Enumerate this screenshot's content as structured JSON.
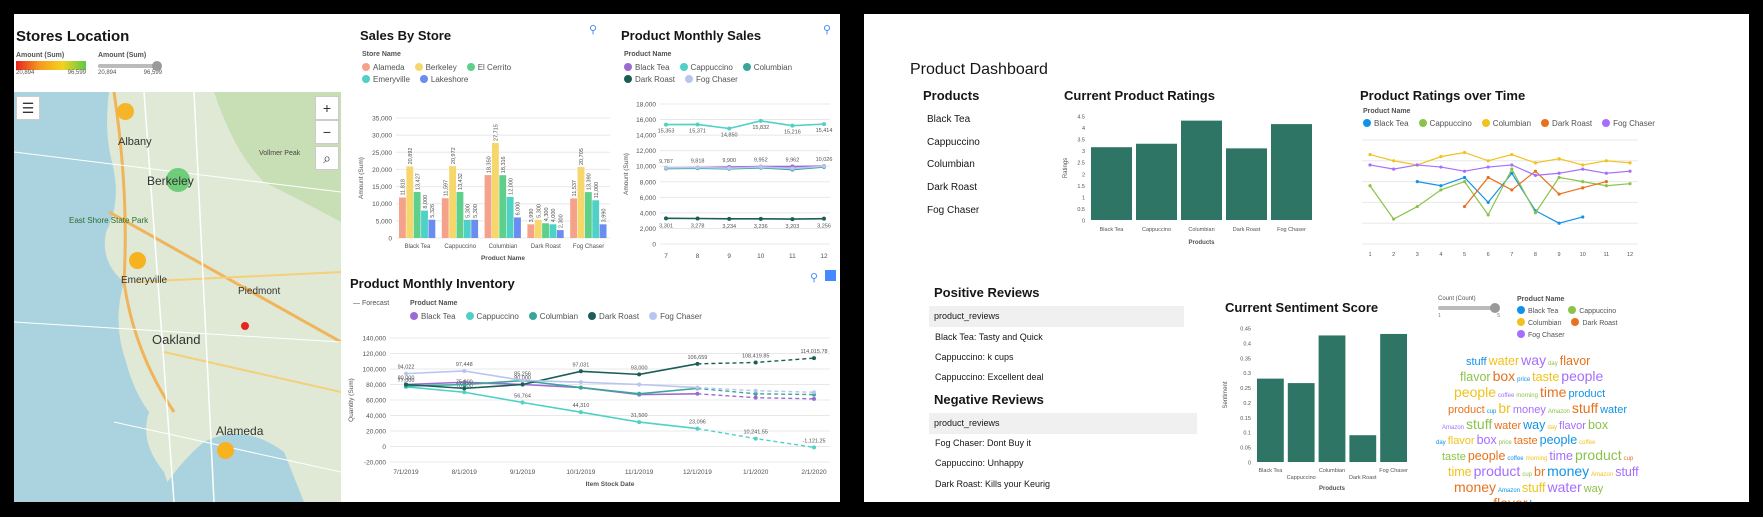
{
  "left": {
    "map": {
      "title": "Stores Location",
      "legend_amount_label": "Amount (Sum)",
      "legend_amount_min": "20,894",
      "legend_amount_max": "96,599",
      "legend_size_label": "Amount (Sum)",
      "legend_size_min": "20,894",
      "legend_size_max": "96,599",
      "places": [
        "Albany",
        "Berkeley",
        "East Shore State Park",
        "Emeryville",
        "Piedmont",
        "Oakland",
        "Alameda",
        "Vollmer Peak"
      ],
      "zoom_in": "+",
      "zoom_out": "−"
    },
    "sales_by_store": {
      "title": "Sales By Store",
      "legend_title": "Store Name",
      "x_title": "Product Name",
      "y_title": "Amount (Sum)"
    },
    "monthly_sales": {
      "title": "Product Monthly Sales",
      "legend_title": "Product Name",
      "y_title": "Amount (Sum)"
    },
    "inventory": {
      "title": "Product Monthly Inventory",
      "forecast_label": "Forecast",
      "legend_title": "Product Name",
      "x_title": "Item Stock Date",
      "y_title": "Quantity (Sum)"
    }
  },
  "right": {
    "title": "Product Dashboard",
    "products_heading": "Products",
    "products": [
      "Black Tea",
      "Cappuccino",
      "Columbian",
      "Dark Roast",
      "Fog Chaser"
    ],
    "ratings": {
      "title": "Current Product Ratings",
      "x_title": "Products",
      "y_title": "Ratings"
    },
    "ratings_time": {
      "title": "Product Ratings over Time",
      "legend_title": "Product Name"
    },
    "positive": {
      "title": "Positive Reviews",
      "header": "product_reviews",
      "rows": [
        "Black Tea: Tasty and Quick",
        "Cappuccino: k cups",
        "Cappuccino: Excellent deal"
      ]
    },
    "negative": {
      "title": "Negative Reviews",
      "header": "product_reviews",
      "rows": [
        "Fog Chaser: Dont Buy it",
        "Cappuccino: Unhappy",
        "Dark Roast: Kills your Keurig"
      ]
    },
    "sentiment": {
      "title": "Current Sentiment Score",
      "x_title": "Products",
      "y_title": "Sentiment"
    },
    "wordcloud": {
      "count_label": "Count (Count)",
      "count_min": "1",
      "count_max": "5",
      "legend_title": "Product Name",
      "words": [
        "stuff",
        "taste",
        "br",
        "flavor",
        "time",
        "water",
        "people",
        "money",
        "box",
        "product",
        "way",
        "coffee",
        "Amazon",
        "price",
        "cup",
        "day",
        "morning"
      ]
    }
  },
  "colors": {
    "teal": "#2e7565",
    "blacktea": "#6929c4",
    "cappuccino": "#1192e8",
    "columbian": "#005d5d",
    "darkroast": "#9f1853",
    "fogchaser": "#fa4d56"
  },
  "chart_data": [
    {
      "id": "sales_by_store",
      "type": "bar",
      "title": "Sales By Store",
      "xlabel": "Product Name",
      "ylabel": "Amount (Sum)",
      "ylim": [
        0,
        35000
      ],
      "yticks": [
        "0",
        "5,000",
        "10,000",
        "15,000",
        "20,000",
        "25,000",
        "30,000",
        "35,000"
      ],
      "categories": [
        "Black Tea",
        "Cappuccino",
        "Columbian",
        "Dark Roast",
        "Fog Chaser"
      ],
      "series": [
        {
          "name": "Alameda",
          "color": "#f4a38a",
          "values": [
            11818,
            11597,
            18350,
            3990,
            11537
          ]
        },
        {
          "name": "Berkeley",
          "color": "#f7d76c",
          "values": [
            20892,
            20972,
            27715,
            5300,
            20705
          ]
        },
        {
          "name": "El Cerrito",
          "color": "#5fcf8c",
          "values": [
            13427,
            13432,
            18316,
            4300,
            13390
          ]
        },
        {
          "name": "Emeryville",
          "color": "#4fd1c5",
          "values": [
            8000,
            5300,
            12000,
            4000,
            11000
          ]
        },
        {
          "name": "Lakeshore",
          "color": "#6b8cf0",
          "values": [
            5326,
            5300,
            6000,
            2300,
            3990
          ]
        }
      ],
      "labels_shown": [
        "11,818",
        "20,892",
        "13,427",
        "5,326",
        "11,597",
        "20,972",
        "5,300",
        "18,348",
        "27,715",
        "18,316",
        "5,600",
        "3,990",
        "11,537",
        "20,705",
        "13,390"
      ]
    },
    {
      "id": "monthly_sales",
      "type": "line",
      "title": "Product Monthly Sales",
      "ylabel": "Amount (Sum)",
      "x": [
        "7",
        "8",
        "9",
        "10",
        "11",
        "12"
      ],
      "ylim": [
        0,
        18000
      ],
      "yticks": [
        "0",
        "2,000",
        "4,000",
        "6,000",
        "8,000",
        "10,000",
        "12,000",
        "14,000",
        "16,000",
        "18,000"
      ],
      "series": [
        {
          "name": "Black Tea",
          "color": "#9b6bd4",
          "values": [
            9787,
            9818,
            9900,
            9952,
            9962,
            10026
          ]
        },
        {
          "name": "Cappuccino",
          "color": "#4fd1c5",
          "values": [
            15353,
            15371,
            14850,
            15832,
            15216,
            15414
          ]
        },
        {
          "name": "Columbian",
          "color": "#3aa69a",
          "values": [
            9700,
            9750,
            9670,
            9800,
            9562,
            9900
          ]
        },
        {
          "name": "Dark Roast",
          "color": "#1b5e56",
          "values": [
            3301,
            3278,
            3234,
            3236,
            3203,
            3256
          ]
        },
        {
          "name": "Fog Chaser",
          "color": "#b8c5f0",
          "values": [
            9800,
            9850,
            9750,
            9900,
            9700,
            10000
          ]
        }
      ],
      "labels_shown": [
        "15,353",
        "15,371",
        "14,850",
        "15,832",
        "15,216",
        "15,414",
        "9,787",
        "9,818",
        "9,670",
        "9,952",
        "9,562",
        "10,026",
        "3,301",
        "3,278",
        "3,234",
        "3,236",
        "3,203",
        "3,256"
      ]
    },
    {
      "id": "inventory",
      "type": "line",
      "title": "Product Monthly Inventory",
      "xlabel": "Item Stock Date",
      "ylabel": "Quantity (Sum)",
      "x": [
        "7/1/2019",
        "8/1/2019",
        "9/1/2019",
        "10/1/2019",
        "11/1/2019",
        "12/1/2019",
        "1/1/2020",
        "2/1/2020"
      ],
      "ylim": [
        -20000,
        140000
      ],
      "yticks": [
        "-20,000",
        "0",
        "20,000",
        "40,000",
        "60,000",
        "80,000",
        "100,000",
        "120,000",
        "140,000"
      ],
      "forecast_from_index": 5,
      "series": [
        {
          "name": "Black Tea",
          "color": "#9b6bd4",
          "values": [
            80000,
            82903,
            80000,
            76000,
            66951,
            68000,
            63000,
            61500
          ]
        },
        {
          "name": "Cappuccino",
          "color": "#4fd1c5",
          "values": [
            77000,
            70000,
            56764,
            44310,
            31500,
            23096,
            10241.55,
            -1121.25
          ]
        },
        {
          "name": "Columbian",
          "color": "#3aa69a",
          "values": [
            78000,
            80000,
            85000,
            76000,
            68000,
            75000,
            68000,
            67000
          ]
        },
        {
          "name": "Dark Roast",
          "color": "#1b5e56",
          "values": [
            80000,
            75000,
            80000,
            97031,
            93000,
            106659,
            108419.85,
            114015.78
          ]
        },
        {
          "name": "Fog Chaser",
          "color": "#b8c5f0",
          "values": [
            94022,
            97448,
            85256,
            83000,
            80000,
            76000,
            72000,
            70000
          ]
        }
      ],
      "labels_shown": [
        "94,022",
        "80,8..",
        "97,448",
        "82,903",
        "85,256",
        "56,764",
        "97,031",
        "76,913",
        "44,310",
        "66,951",
        "31,500",
        "106,659",
        "23,096",
        "108,419.85",
        "114,015.78",
        "10,241.55",
        "-1,121.25"
      ]
    },
    {
      "id": "current_product_ratings",
      "type": "bar",
      "title": "Current Product Ratings",
      "xlabel": "Products",
      "ylabel": "Ratings",
      "ylim": [
        0,
        4.5
      ],
      "yticks": [
        "0",
        "0.5",
        "1",
        "1.5",
        "2",
        "2.5",
        "3",
        "3.5",
        "4",
        "4.5"
      ],
      "categories": [
        "Black Tea",
        "Cappuccino",
        "Columbian",
        "Dark Roast",
        "Fog Chaser"
      ],
      "values": [
        3.15,
        3.3,
        4.3,
        3.1,
        4.15
      ]
    },
    {
      "id": "ratings_over_time",
      "type": "line",
      "title": "Product Ratings over Time",
      "x": [
        "1",
        "2",
        "3",
        "4",
        "5",
        "6",
        "7",
        "8",
        "9",
        "10",
        "11",
        "12"
      ],
      "ylim": [
        0,
        5
      ],
      "series": [
        {
          "name": "Black Tea",
          "color": "#1192e8",
          "values": [
            null,
            null,
            3.0,
            2.8,
            3.2,
            2.0,
            3.4,
            1.6,
            1.0,
            1.3,
            null,
            null
          ]
        },
        {
          "name": "Cappuccino",
          "color": "#8bc34a",
          "values": [
            2.8,
            1.2,
            1.8,
            2.6,
            3.0,
            1.4,
            3.6,
            1.5,
            3.2,
            3.0,
            2.8,
            2.9
          ]
        },
        {
          "name": "Columbian",
          "color": "#f1c21b",
          "values": [
            4.3,
            4.0,
            3.8,
            4.2,
            4.4,
            4.0,
            4.3,
            3.9,
            4.1,
            3.8,
            4.0,
            3.9
          ]
        },
        {
          "name": "Dark Roast",
          "color": "#e8711d",
          "values": [
            null,
            null,
            null,
            null,
            1.8,
            3.2,
            2.6,
            3.5,
            2.4,
            2.7,
            3.0,
            null
          ]
        },
        {
          "name": "Fog Chaser",
          "color": "#a56eff",
          "values": [
            3.8,
            3.6,
            3.8,
            3.7,
            3.5,
            3.7,
            3.8,
            3.3,
            3.4,
            3.6,
            3.4,
            3.5
          ]
        }
      ]
    },
    {
      "id": "current_sentiment",
      "type": "bar",
      "title": "Current Sentiment Score",
      "xlabel": "Products",
      "ylabel": "Sentiment",
      "ylim": [
        0,
        0.45
      ],
      "yticks": [
        "0",
        "0.05",
        "0.1",
        "0.15",
        "0.2",
        "0.25",
        "0.3",
        "0.35",
        "0.4",
        "0.45"
      ],
      "categories": [
        "Black Tea",
        "Cappuccino",
        "Columbian",
        "Dark Roast",
        "Fog Chaser"
      ],
      "values": [
        0.28,
        0.265,
        0.425,
        0.09,
        0.43
      ]
    }
  ]
}
